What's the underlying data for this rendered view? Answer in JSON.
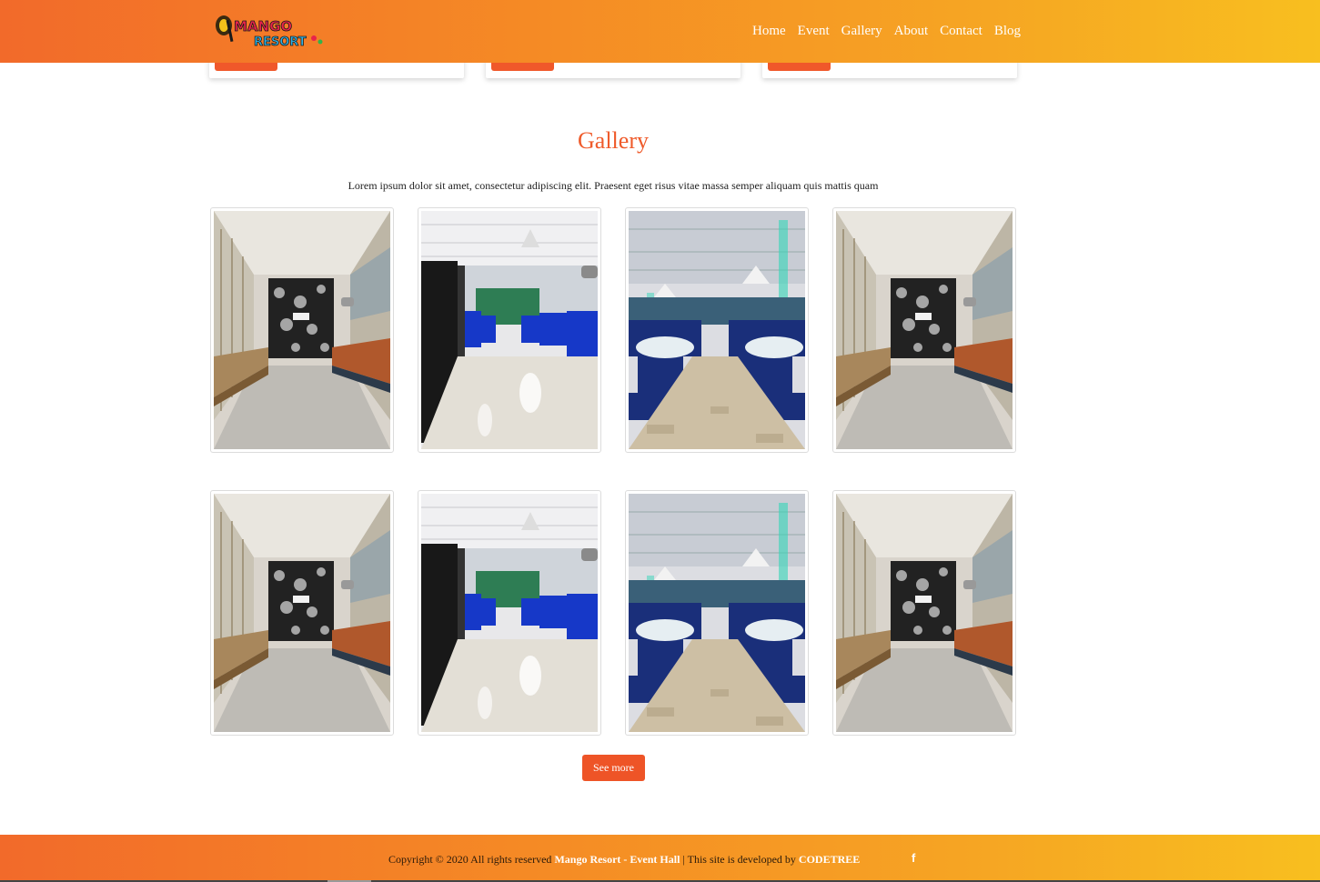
{
  "header": {
    "logo": {
      "icon": "mango-resort-logo",
      "line1": "MANGO",
      "line2": "RESORT"
    },
    "nav": [
      "Home",
      "Event",
      "Gallery",
      "About",
      "Contact",
      "Blog"
    ]
  },
  "gallery": {
    "title": "Gallery",
    "description": "Lorem ipsum dolor sit amet, consectetur adipiscing elit. Praesent eget risus vitae massa semper aliquam quis mattis quam",
    "photos": [
      "lounge-hallway-photo",
      "blue-chair-hall-photo",
      "banquet-tables-photo",
      "lounge-hallway-photo",
      "lounge-hallway-photo",
      "blue-chair-hall-photo",
      "banquet-tables-photo",
      "lounge-hallway-photo"
    ],
    "see_more_label": "See more"
  },
  "footer": {
    "copyright": "Copyright © 2020 All rights reserved",
    "brand": "Mango Resort - Event Hall",
    "developed": "| This site is developed by",
    "developer": "CODETREE",
    "social_icon": "facebook-icon",
    "social_glyph": "f"
  },
  "colors": {
    "accent": "#ef5b2b",
    "gradient_start": "#f26a2a",
    "gradient_end": "#f8bf1f"
  }
}
